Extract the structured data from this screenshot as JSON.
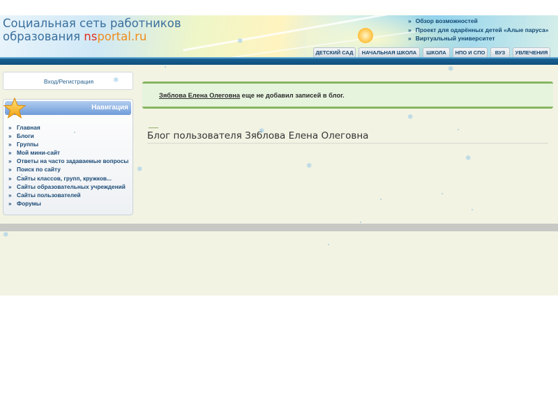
{
  "header": {
    "title_line1": "Социальная сеть работников",
    "title_line2_prefix": "образования ",
    "title_accent": "ns",
    "title_domain": "portal.ru",
    "top_links": [
      "Обзор возможностей",
      "Проект для одарённых детей «Алые паруса»",
      "Виртуальный университет"
    ],
    "bullet": "»",
    "tabs": [
      "ДЕТСКИЙ САД",
      "НАЧАЛЬНАЯ ШКОЛА",
      "ШКОЛА",
      "НПО И СПО",
      "ВУЗ",
      "УВЛЕЧЕНИЯ"
    ]
  },
  "sidebar": {
    "login_label": "Вход/Регистрация",
    "nav_title": "Навигация",
    "bullet": "»",
    "nav_items": [
      "Главная",
      "Блоги",
      "Группы",
      "Мой мини-сайт",
      "Ответы на часто задаваемые вопросы",
      "Поиск по сайту",
      "Сайты классов, групп, кружков...",
      "Сайты образовательных учреждений",
      "Сайты пользователей",
      "Форумы"
    ]
  },
  "main": {
    "notice_user": "Зяблова Елена Олеговна",
    "notice_rest": " еще не добавил записей в блог.",
    "blog_title": "Блог пользователя Зяблова Елена Олеговна"
  },
  "colors": {
    "header_blue": "#0e4f7f",
    "link_blue": "#1b4a76",
    "notice_green": "#86b561",
    "content_bg": "#f2f3e3",
    "accent_red": "#e0301e",
    "accent_orange": "#f08b19"
  }
}
